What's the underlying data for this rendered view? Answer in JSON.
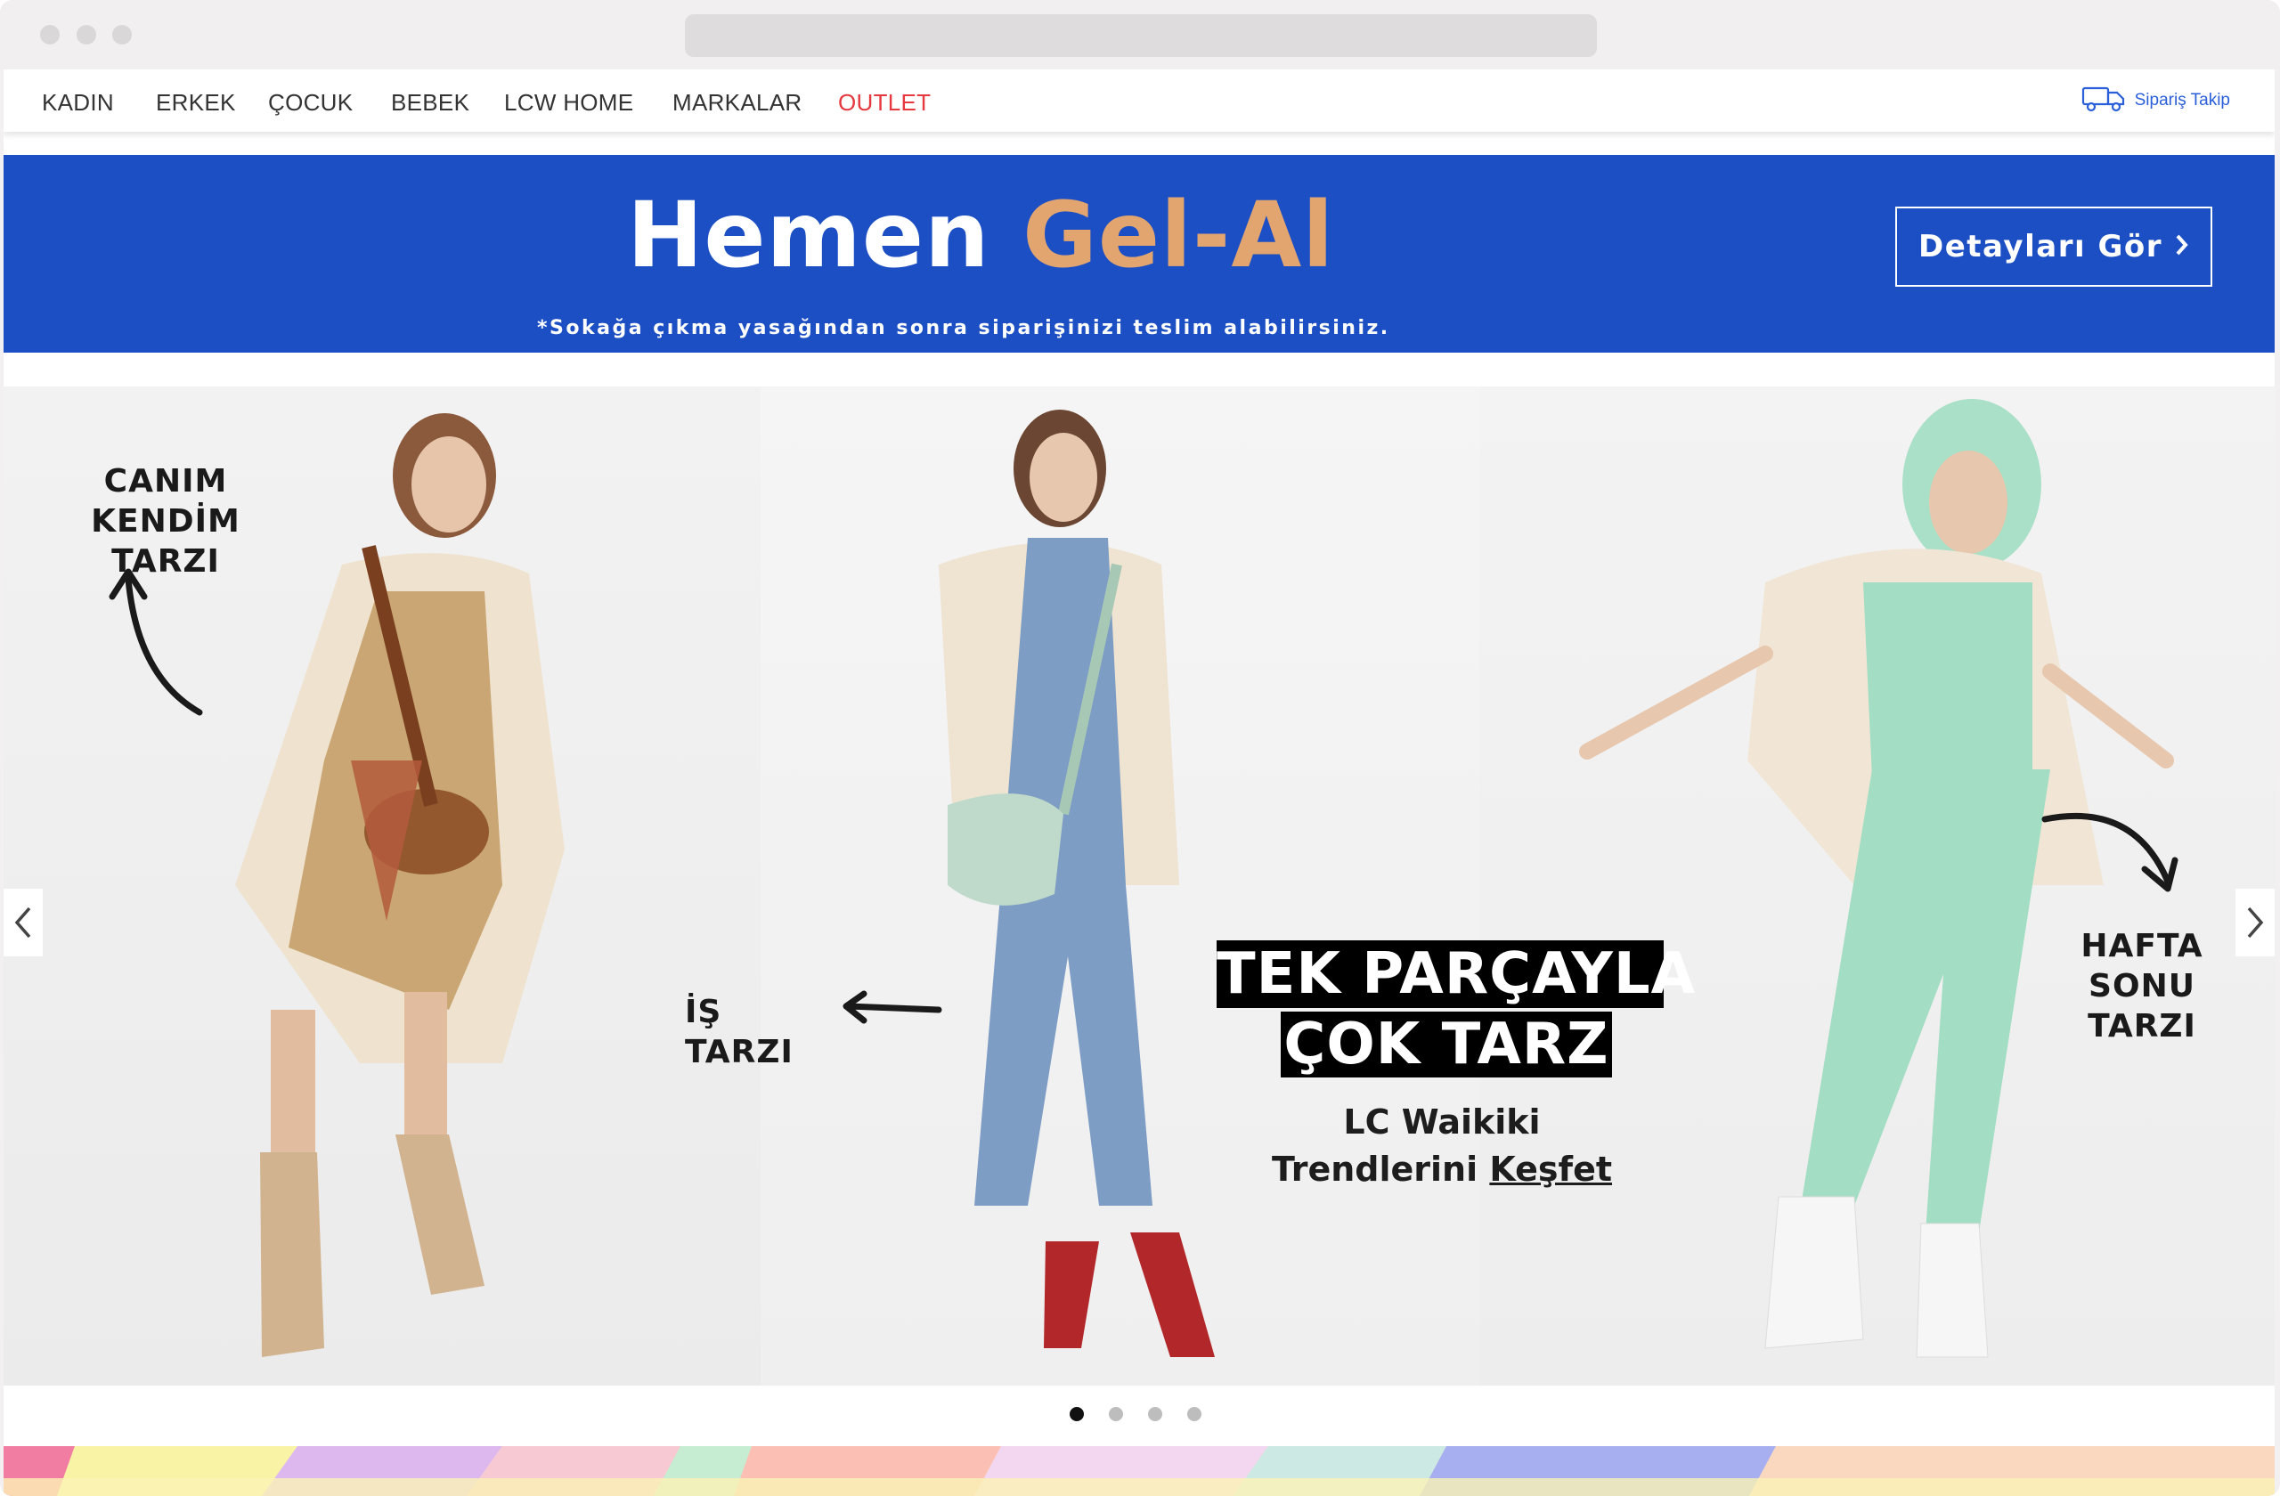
{
  "nav": {
    "items": [
      "KADIN",
      "ERKEK",
      "ÇOCUK",
      "BEBEK",
      "LCW HOME",
      "MARKALAR",
      "OUTLET"
    ],
    "order_tracking": "Sipariş Takip"
  },
  "promo": {
    "title_white": "Hemen ",
    "title_gold": "Gel-Al",
    "subtitle": "*Sokağa çıkma yasağından sonra siparişinizi teslim alabilirsiniz.",
    "button": "Detayları Gör",
    "bg_color": "#1c4fc3",
    "accent_color": "#e3a570"
  },
  "hero": {
    "callout_left_1": "CANIM KENDİM",
    "callout_left_2": "TARZI",
    "callout_middle": "İŞ TARZI",
    "callout_right_1": "HAFTA SONU",
    "callout_right_2": "TARZI",
    "headline_1": "TEK PARÇAYLA",
    "headline_2": "ÇOK TARZ",
    "sub_1": "LC Waikiki",
    "sub_2a": "Trendlerini ",
    "sub_2b": "Keşfet"
  },
  "carousel": {
    "dot_count": 4,
    "active_index": 0
  }
}
